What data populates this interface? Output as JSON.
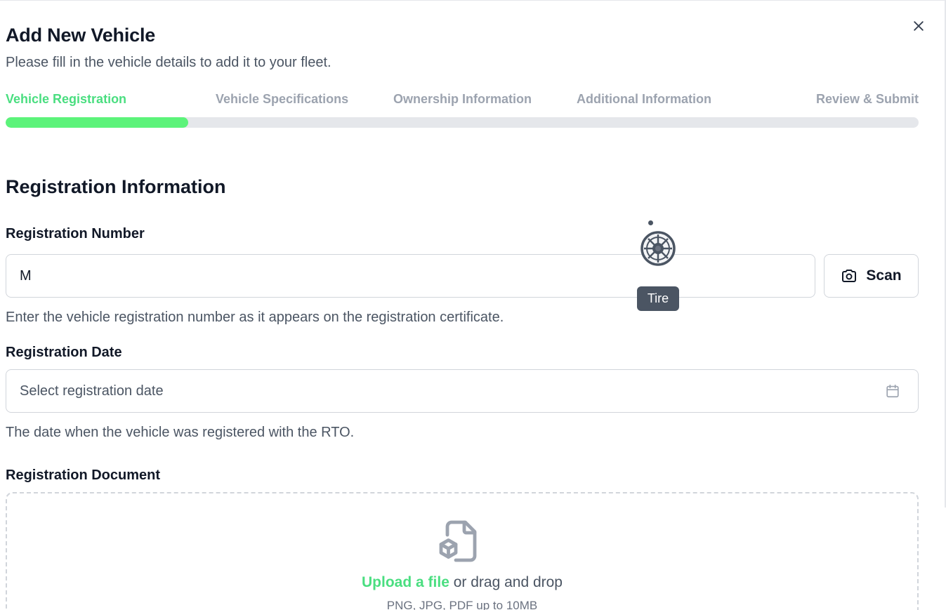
{
  "header": {
    "title": "Add New Vehicle",
    "subtitle": "Please fill in the vehicle details to add it to your fleet.",
    "close_icon": "close-icon"
  },
  "steps": [
    {
      "label": "Vehicle Registration",
      "active": true
    },
    {
      "label": "Vehicle Specifications",
      "active": false
    },
    {
      "label": "Ownership Information",
      "active": false
    },
    {
      "label": "Additional Information",
      "active": false
    },
    {
      "label": "Review & Submit",
      "active": false
    }
  ],
  "progress": {
    "current_step": 1,
    "total_steps": 5,
    "fraction": 0.2
  },
  "section": {
    "title": "Registration Information"
  },
  "registration_number": {
    "label": "Registration Number",
    "value": "M",
    "help": "Enter the vehicle registration number as it appears on the registration certificate.",
    "scan_label": "Scan",
    "scan_icon": "camera-icon"
  },
  "registration_date": {
    "label": "Registration Date",
    "placeholder": "Select registration date",
    "help": "The date when the vehicle was registered with the RTO.",
    "icon": "calendar-icon"
  },
  "registration_document": {
    "label": "Registration Document",
    "upload_link": "Upload a file",
    "upload_text": " or drag and drop",
    "hint": "PNG, JPG, PDF up to 10MB",
    "icon": "file-box-icon"
  },
  "cursor": {
    "icon": "tire-icon",
    "tooltip": "Tire"
  },
  "colors": {
    "accent": "#4ade80",
    "progress": "#5cf37a",
    "track": "#e5e7eb",
    "tooltip_bg": "#4b5563"
  }
}
